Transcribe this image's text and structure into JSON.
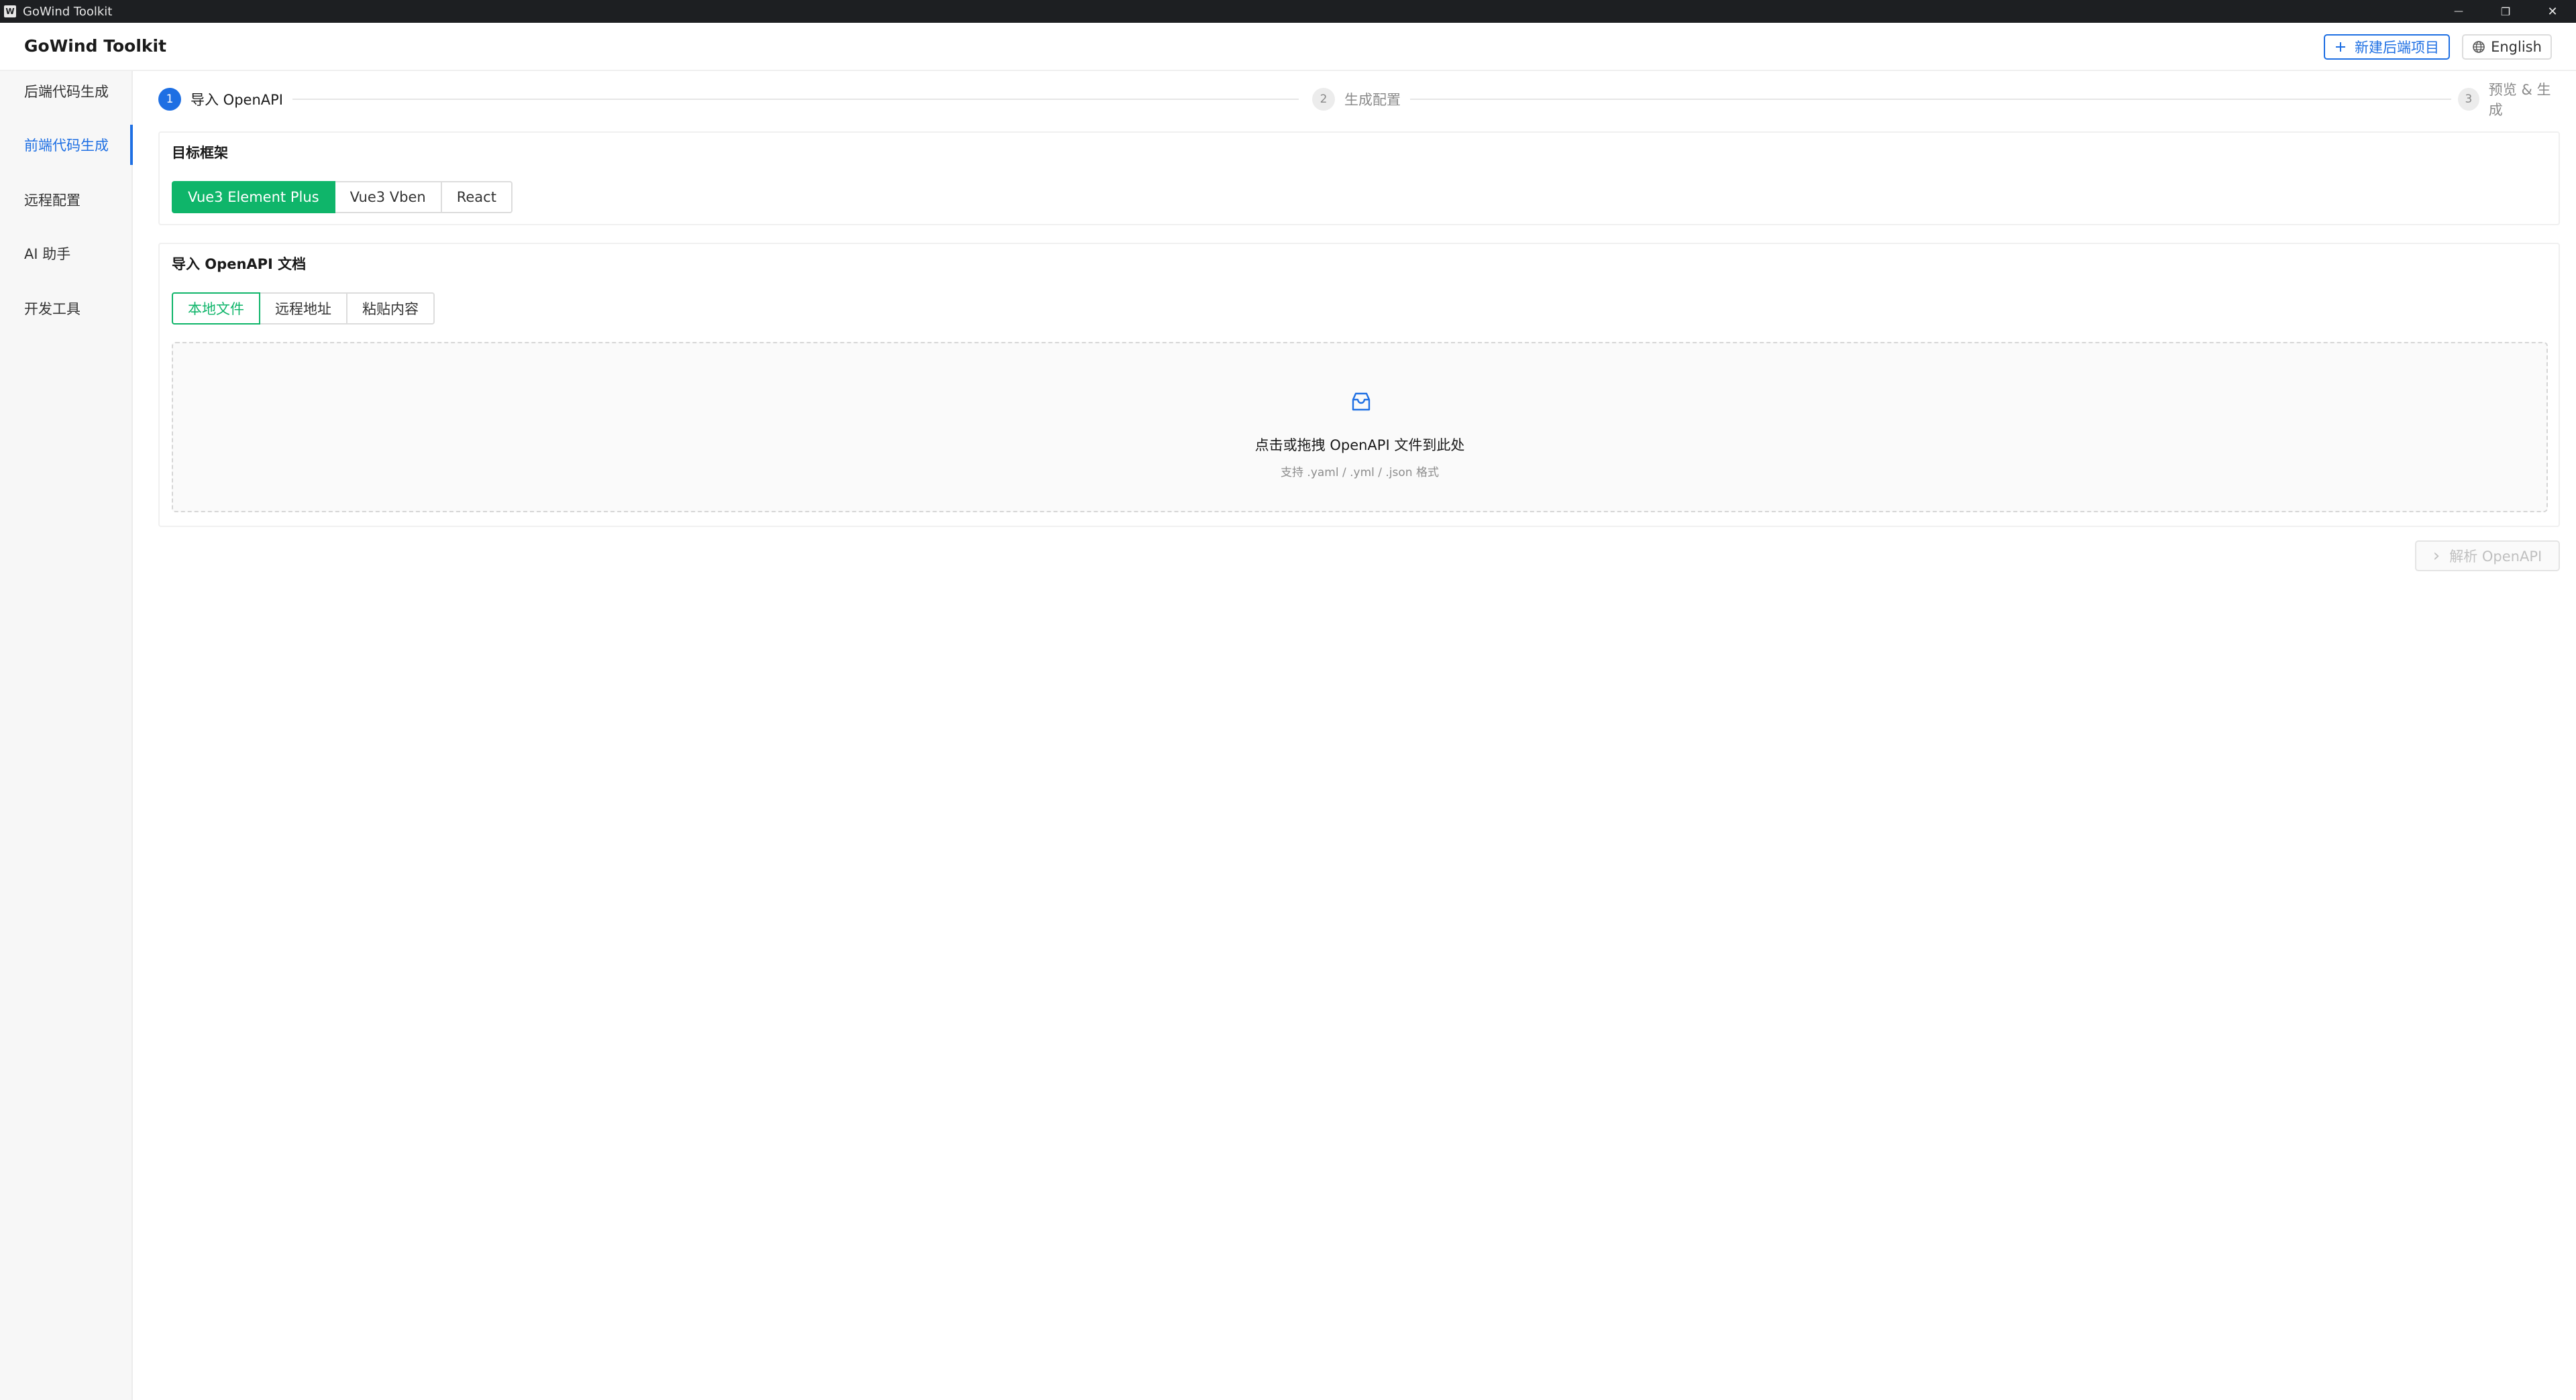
{
  "window": {
    "title": "GoWind Toolkit",
    "app_icon_glyph": "W",
    "minimize_glyph": "—",
    "restore_glyph": "❐",
    "close_glyph": "✕"
  },
  "header": {
    "brand": "GoWind Toolkit",
    "new_project_label": "新建后端项目",
    "language_label": "English"
  },
  "sidebar": {
    "items": [
      {
        "label": "后端代码生成",
        "active": false
      },
      {
        "label": "前端代码生成",
        "active": true
      },
      {
        "label": "远程配置",
        "active": false
      },
      {
        "label": "AI 助手",
        "active": false
      },
      {
        "label": "开发工具",
        "active": false
      }
    ]
  },
  "steps": [
    {
      "number": "1",
      "label": "导入 OpenAPI",
      "active": true
    },
    {
      "number": "2",
      "label": "生成配置",
      "active": false
    },
    {
      "number": "3",
      "label": "预览 & 生成",
      "active": false
    }
  ],
  "framework": {
    "title": "目标框架",
    "options": [
      "Vue3 Element Plus",
      "Vue3 Vben",
      "React"
    ],
    "selected": "Vue3 Element Plus"
  },
  "import": {
    "title": "导入 OpenAPI 文档",
    "tabs": [
      "本地文件",
      "远程地址",
      "粘贴内容"
    ],
    "selected_tab": "本地文件",
    "dropzone_text": "点击或拖拽 OpenAPI 文件到此处",
    "dropzone_hint": "支持 .yaml / .yml / .json 格式"
  },
  "actions": {
    "parse_label": "解析 OpenAPI",
    "parse_glyph": "›"
  },
  "colors": {
    "accent_blue": "#1e6fe3",
    "accent_green": "#0fb56a",
    "disabled_text": "#c0c0c0"
  }
}
